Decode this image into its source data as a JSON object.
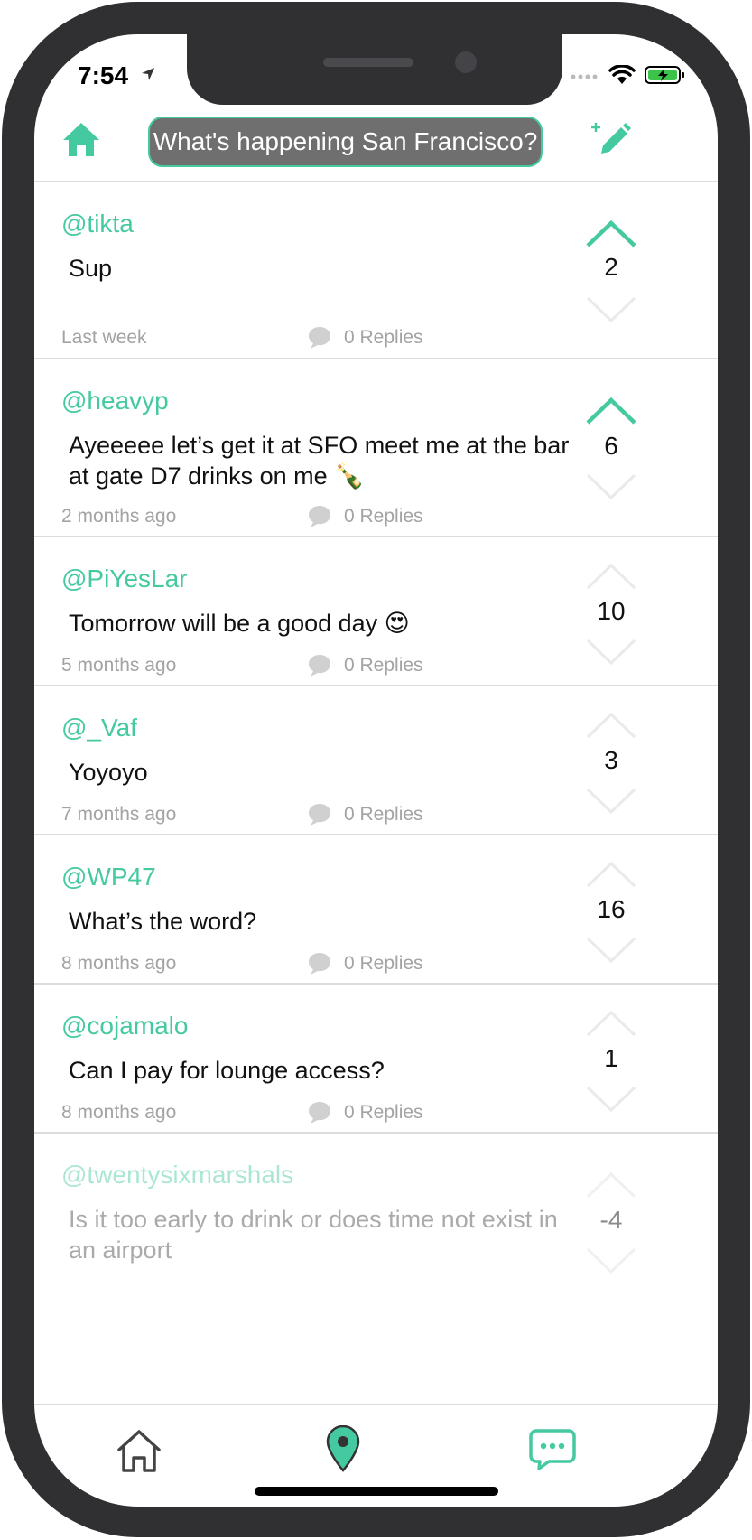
{
  "status_bar": {
    "time": "7:54"
  },
  "header": {
    "title": "What's happening San Francisco?"
  },
  "posts": [
    {
      "author": "@tikta",
      "body": "Sup",
      "time": "Last week",
      "replies": "0 Replies",
      "score": "2",
      "upvoted": true
    },
    {
      "author": "@heavyp",
      "body": "Ayeeeee let’s get it at SFO meet me at the bar at gate D7 drinks on me 🍾",
      "time": "2 months ago",
      "replies": "0 Replies",
      "score": "6",
      "upvoted": true
    },
    {
      "author": "@PiYesLar",
      "body": "Tomorrow will be a good day 😍",
      "time": "5 months ago",
      "replies": "0 Replies",
      "score": "10",
      "upvoted": false
    },
    {
      "author": "@_Vaf",
      "body": "Yoyoyo",
      "time": "7 months ago",
      "replies": "0 Replies",
      "score": "3",
      "upvoted": false
    },
    {
      "author": "@WP47",
      "body": "What’s the word?",
      "time": "8 months ago",
      "replies": "0 Replies",
      "score": "16",
      "upvoted": false
    },
    {
      "author": "@cojamalo",
      "body": "Can I pay for lounge access?",
      "time": "8 months ago",
      "replies": "0 Replies",
      "score": "1",
      "upvoted": false
    },
    {
      "author": "@twentysixmarshals",
      "body": "Is it too early to drink or does time not exist in an airport",
      "time": "",
      "replies": "",
      "score": "-4",
      "upvoted": false
    }
  ],
  "icons": {
    "header_home": "home-icon",
    "compose": "compose-icon",
    "reply": "speech-bubble-icon",
    "upvote": "chevron-up-icon",
    "downvote": "chevron-down-icon",
    "tab_home": "home-outline-icon",
    "tab_location": "location-pin-icon",
    "tab_messages": "chat-bubble-icon"
  },
  "colors": {
    "accent": "#45c9a0",
    "title_bg": "#6f6f6f",
    "muted": "#a3a3a3",
    "vote_inactive": "#eaeaea"
  }
}
